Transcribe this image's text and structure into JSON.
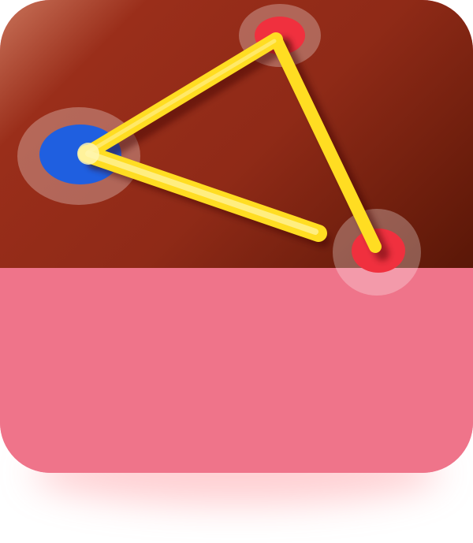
{
  "icon": {
    "colors": {
      "top_gradient": [
        "#c9735a",
        "#9a2e1a",
        "#8f2a17",
        "#5a1707"
      ],
      "bottom_panel": "#ef748a",
      "edge": "#ffdd22",
      "edge_glow": "#fff3a0",
      "node_blue": "#1f5fe0",
      "node_red": "#f0303e",
      "node_halo": "rgba(255,255,255,0.30)"
    },
    "nodes": [
      {
        "name": "blue-node",
        "color": "blue",
        "role": "start"
      },
      {
        "name": "red-node-top",
        "color": "red"
      },
      {
        "name": "red-node-bottom",
        "color": "red"
      }
    ],
    "edges": [
      {
        "name": "edge-blue-to-top",
        "from": "blue-node",
        "to": "red-node-top"
      },
      {
        "name": "edge-top-to-bottom",
        "from": "red-node-top",
        "to": "red-node-bottom"
      },
      {
        "name": "edge-blue-to-open-end",
        "from": "blue-node",
        "to": "open-end"
      }
    ]
  }
}
